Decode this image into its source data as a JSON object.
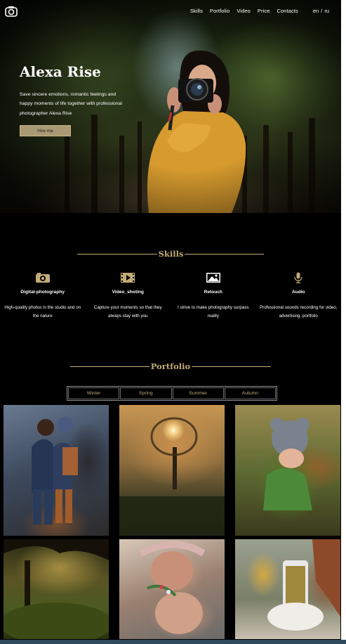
{
  "nav": {
    "items": [
      "Skills",
      "Portfolio",
      "Video",
      "Price",
      "Contacts"
    ],
    "lang": [
      "en",
      "/",
      "ru"
    ]
  },
  "hero": {
    "title": "Alexa Rise",
    "text": "Save sincere emotions, romantic feelings and happy moments of life together with professional photographer Alexa Rise",
    "button": "Hire me"
  },
  "skills": {
    "title": "Skills",
    "items": [
      {
        "icon": "camera-icon",
        "title": "Digital-photography",
        "desc": "High-quality photos in the studio and on the nature"
      },
      {
        "icon": "video-icon",
        "title": "Video_shoting",
        "desc": "Capture your moments so that they always stay with you"
      },
      {
        "icon": "image-icon",
        "title": "Retouch",
        "desc": "I strive to make photography surpass reality"
      },
      {
        "icon": "microphone-icon",
        "title": "Audio",
        "desc": "Professional sounds recording for video, advertising, portfolio"
      }
    ]
  },
  "portfolio": {
    "title": "Portfolio",
    "tabs": [
      "Winter",
      "Spring",
      "Summer",
      "Autumn"
    ]
  },
  "colors": {
    "accent": "#c2ab77",
    "button": "#aa9a74",
    "background": "#000000"
  }
}
